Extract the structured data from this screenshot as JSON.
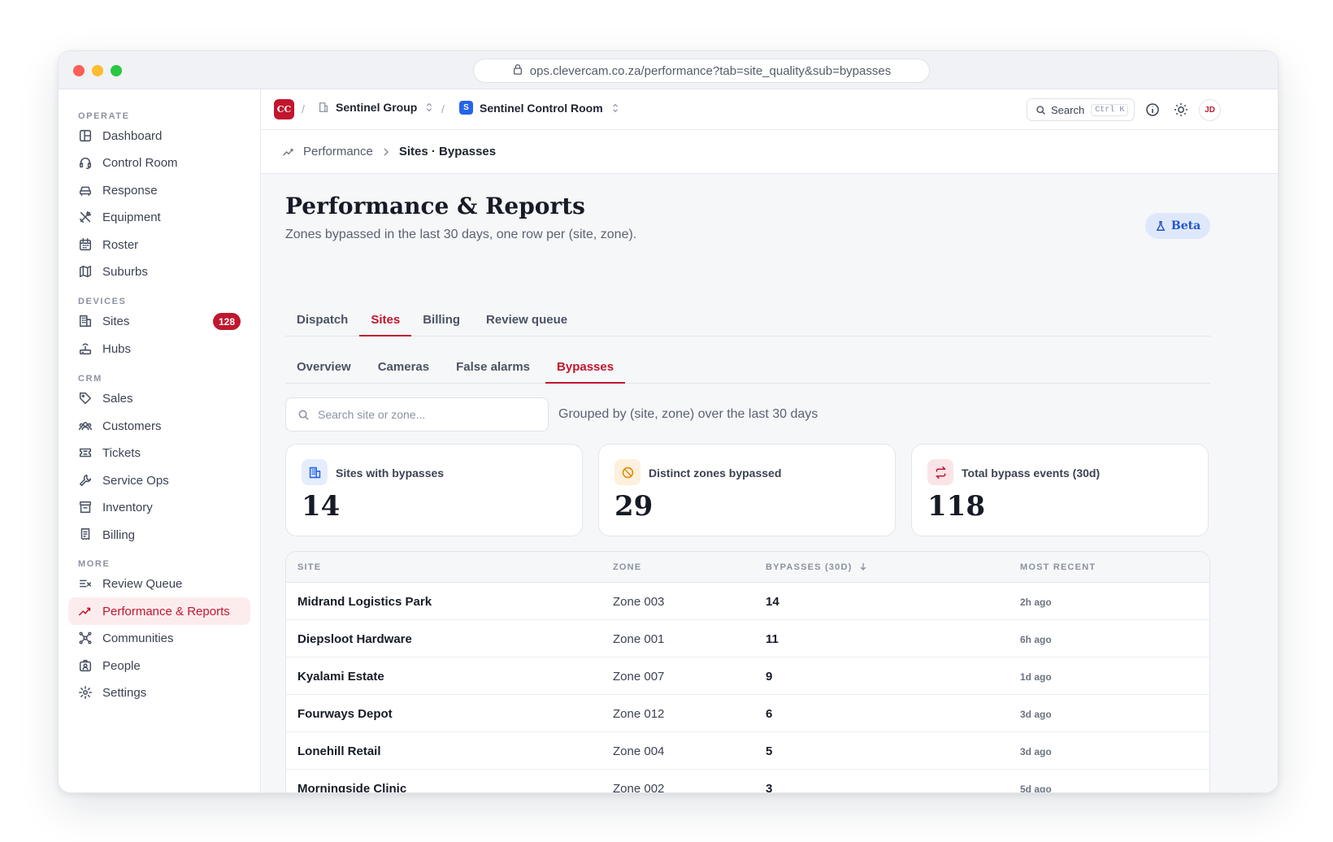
{
  "browser": {
    "url": "ops.clevercam.co.za/performance?tab=site_quality&sub=bypasses"
  },
  "sidebar": {
    "sections": [
      {
        "label": "OPERATE"
      },
      {
        "label": "DEVICES"
      },
      {
        "label": "CRM"
      },
      {
        "label": "MORE"
      }
    ],
    "items": [
      {
        "label": "Dashboard",
        "icon": "dashboard-icon"
      },
      {
        "label": "Control Room",
        "icon": "headset-icon"
      },
      {
        "label": "Response",
        "icon": "car-icon"
      },
      {
        "label": "Equipment",
        "icon": "tools-icon"
      },
      {
        "label": "Roster",
        "icon": "calendar-icon"
      },
      {
        "label": "Suburbs",
        "icon": "map-icon"
      },
      {
        "label": "Sites",
        "icon": "building-icon",
        "badge": "128"
      },
      {
        "label": "Hubs",
        "icon": "router-icon"
      },
      {
        "label": "Sales",
        "icon": "tag-icon"
      },
      {
        "label": "Customers",
        "icon": "users-icon"
      },
      {
        "label": "Tickets",
        "icon": "ticket-icon"
      },
      {
        "label": "Service Ops",
        "icon": "wrench-icon"
      },
      {
        "label": "Inventory",
        "icon": "archive-icon"
      },
      {
        "label": "Billing",
        "icon": "receipt-icon"
      },
      {
        "label": "Review Queue",
        "icon": "list-check-icon"
      },
      {
        "label": "Performance & Reports",
        "icon": "trend-icon",
        "active": true
      },
      {
        "label": "Communities",
        "icon": "network-icon"
      },
      {
        "label": "People",
        "icon": "id-badge-icon"
      },
      {
        "label": "Settings",
        "icon": "gear-icon"
      }
    ]
  },
  "topbar": {
    "logo_text": "CC",
    "org_name": "Sentinel Group",
    "room_badge": "S",
    "room_name": "Sentinel Control Room",
    "search_label": "Search",
    "search_shortcut": "Ctrl K",
    "avatar_initials": "JD"
  },
  "breadcrumb": {
    "parent": "Performance",
    "current": "Sites · Bypasses"
  },
  "page": {
    "title": "Performance & Reports",
    "subtitle": "Zones bypassed in the last 30 days, one row per (site, zone).",
    "beta_label": "Beta"
  },
  "tabs": [
    {
      "label": "Dispatch"
    },
    {
      "label": "Sites",
      "active": true
    },
    {
      "label": "Billing"
    },
    {
      "label": "Review queue"
    }
  ],
  "subtabs": [
    {
      "label": "Overview"
    },
    {
      "label": "Cameras"
    },
    {
      "label": "False alarms"
    },
    {
      "label": "Bypasses",
      "active": true
    }
  ],
  "filter": {
    "placeholder": "Search site or zone...",
    "value": "",
    "note": "Grouped by (site, zone) over the last 30 days"
  },
  "stats": [
    {
      "label": "Sites with bypasses",
      "value": "14",
      "icon": "building-icon",
      "color": "#2563eb",
      "bg": "#e5edfd"
    },
    {
      "label": "Distinct zones bypassed",
      "value": "29",
      "icon": "ban-icon",
      "color": "#e08a00",
      "bg": "#fdf0dc"
    },
    {
      "label": "Total bypass events (30d)",
      "value": "118",
      "icon": "repeat-icon",
      "color": "#c0172e",
      "bg": "#fbe4e7"
    }
  ],
  "table": {
    "columns": {
      "site": "SITE",
      "zone": "ZONE",
      "bypasses": "BYPASSES (30D)",
      "recent": "MOST RECENT"
    },
    "rows": [
      {
        "site": "Midrand Logistics Park",
        "zone": "Zone 003",
        "bypasses": "14",
        "recent": "2h ago"
      },
      {
        "site": "Diepsloot Hardware",
        "zone": "Zone 001",
        "bypasses": "11",
        "recent": "6h ago"
      },
      {
        "site": "Kyalami Estate",
        "zone": "Zone 007",
        "bypasses": "9",
        "recent": "1d ago"
      },
      {
        "site": "Fourways Depot",
        "zone": "Zone 012",
        "bypasses": "6",
        "recent": "3d ago"
      },
      {
        "site": "Lonehill Retail",
        "zone": "Zone 004",
        "bypasses": "5",
        "recent": "3d ago"
      },
      {
        "site": "Morningside Clinic",
        "zone": "Zone 002",
        "bypasses": "3",
        "recent": "5d ago"
      }
    ]
  },
  "colors": {
    "accent": "#c0172e",
    "beta": "#2255c8"
  }
}
